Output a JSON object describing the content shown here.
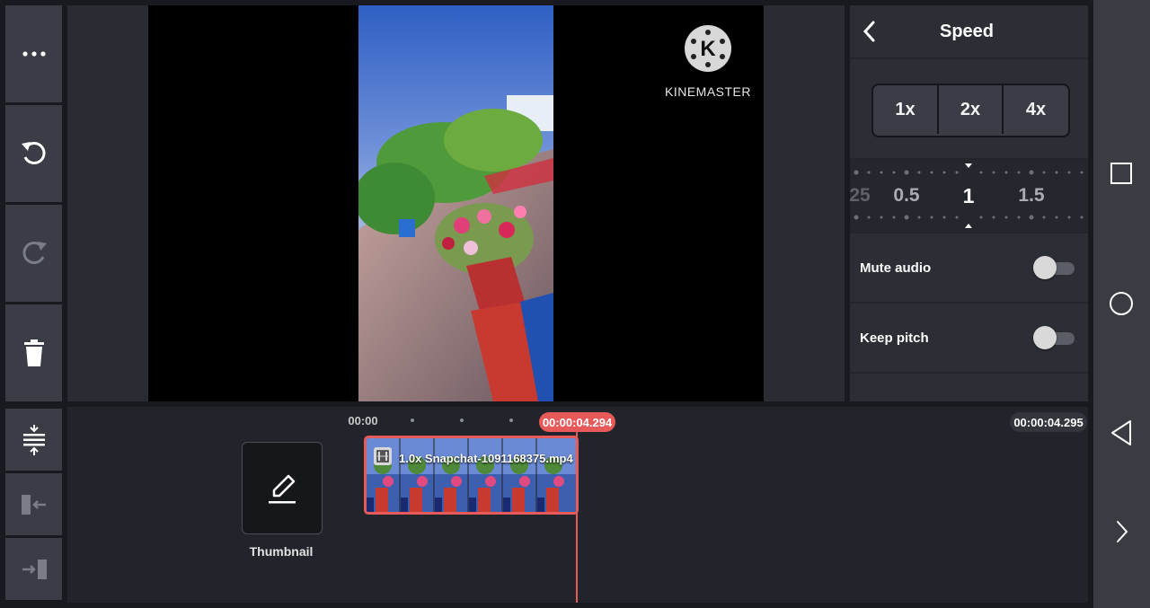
{
  "toolbar": {
    "more_icon": "more-dots-icon",
    "undo_icon": "undo-icon",
    "redo_icon": "redo-icon",
    "delete_icon": "trash-icon",
    "split_icon": "split-track-icon",
    "trim_left_icon": "trim-left-icon",
    "trim_right_icon": "trim-right-icon"
  },
  "preview": {
    "watermark_text": "KINEMASTER"
  },
  "speed_panel": {
    "title": "Speed",
    "presets": [
      "1x",
      "2x",
      "4x"
    ],
    "scale_labels": [
      "25",
      "0.5",
      "1",
      "1.5"
    ],
    "current_speed": 1,
    "options": [
      {
        "label": "Mute audio",
        "on": false
      },
      {
        "label": "Keep pitch",
        "on": false
      }
    ]
  },
  "timeline": {
    "start_time": "00:00",
    "playhead_time": "00:00:04.294",
    "end_time": "00:00:04.295",
    "clip_label": "1.0x Snapchat-1091168375.mp4",
    "thumbnail_label": "Thumbnail"
  },
  "colors": {
    "accent": "#e85a5a",
    "toolbar_bg": "#3a3d46",
    "panel_bg": "#2c2e36"
  }
}
